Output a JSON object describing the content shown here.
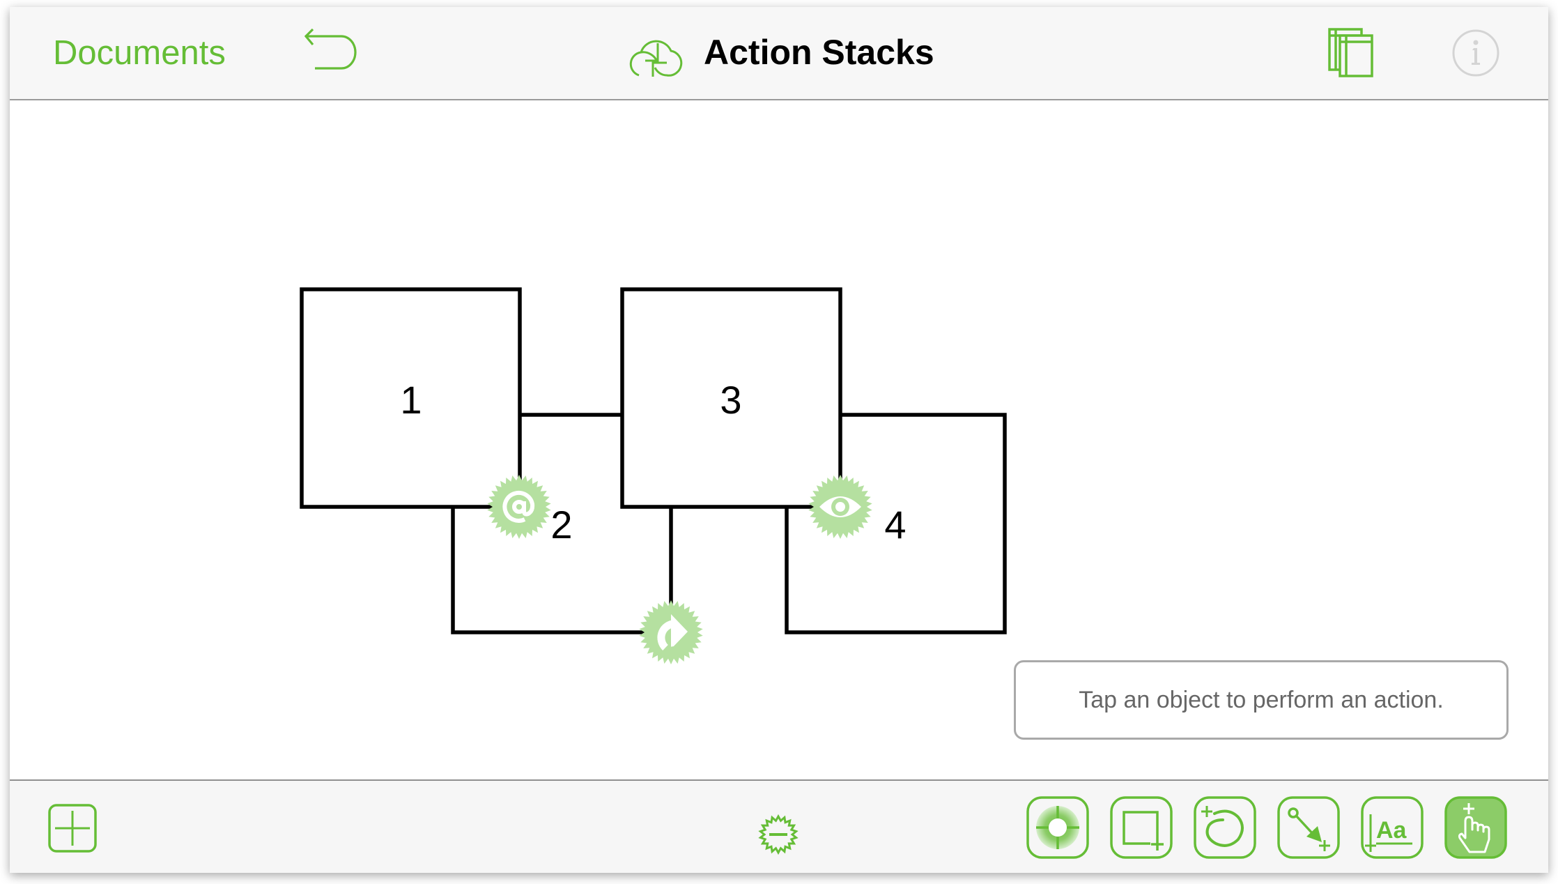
{
  "header": {
    "back_label": "Documents",
    "title": "Action Stacks",
    "undo_icon": "undo-arrow-icon",
    "title_icon": "cloud-sync-icon",
    "docs_icon": "document-pages-icon",
    "info_icon": "info-icon"
  },
  "canvas": {
    "shapes": [
      {
        "label": "1",
        "action_badge": "email-at-icon"
      },
      {
        "label": "2",
        "action_badge": "jump-arrow-icon"
      },
      {
        "label": "3",
        "action_badge": "eye-icon"
      },
      {
        "label": "4",
        "action_badge": null
      }
    ]
  },
  "hint": {
    "text": "Tap an object to perform an action."
  },
  "toolbar": {
    "left_button_icon": "add-canvas-icon",
    "center_icon": "remove-action-badge-icon",
    "tools": [
      {
        "name": "selection-tool",
        "icon": "target-selection-icon",
        "active": false
      },
      {
        "name": "shape-tool",
        "icon": "rectangle-plus-icon",
        "active": false
      },
      {
        "name": "freehand-tool",
        "icon": "lasso-plus-icon",
        "active": false
      },
      {
        "name": "line-tool",
        "icon": "line-arrow-plus-icon",
        "active": false
      },
      {
        "name": "text-tool",
        "icon": "text-aa-icon",
        "active": false
      },
      {
        "name": "action-browse-tool",
        "icon": "hand-pointer-plus-icon",
        "active": true
      }
    ]
  },
  "colors": {
    "accent": "#65bd36",
    "badge": "#b5e0a0",
    "header_bg": "#f7f7f7",
    "active_tool_bg": "#8ccc68"
  }
}
